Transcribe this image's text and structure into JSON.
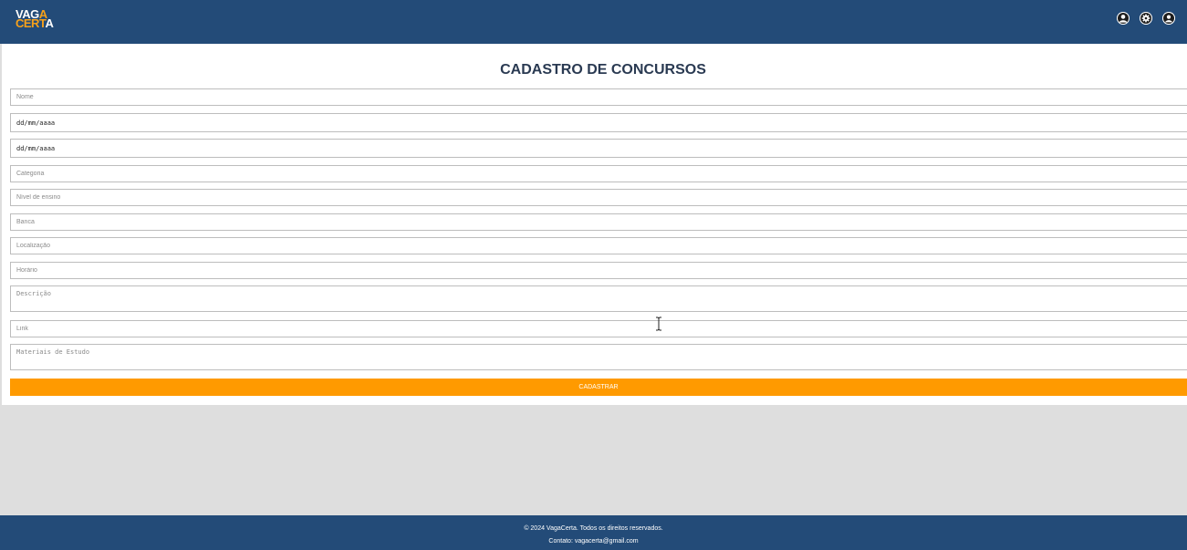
{
  "header": {
    "logo_line1_white": "VAG",
    "logo_line1_accent": "A",
    "logo_line2_accent": "CERT",
    "logo_line2_white": "A",
    "icons": [
      "user-circle-icon",
      "gear-icon",
      "account-icon"
    ]
  },
  "form": {
    "title": "CADASTRO DE CONCURSOS",
    "nome_placeholder": "Nome",
    "data_inicio_value": "dd/mm/aaaa",
    "data_fim_value": "dd/mm/aaaa",
    "categoria_placeholder": "Categoria",
    "nivel_placeholder": "Nível de ensino",
    "banca_placeholder": "Banca",
    "localizacao_placeholder": "Localização",
    "horario_placeholder": "Horário",
    "descricao_placeholder": "Descrição",
    "link_placeholder": "Link",
    "materiais_placeholder": "Materiais de Estudo",
    "submit_label": "CADASTRAR"
  },
  "footer": {
    "copyright": "© 2024 VagaCerta. Todos os direitos reservados.",
    "contact": "Contato: vagacerta@gmail.com"
  },
  "colors": {
    "header_bg": "#234b78",
    "accent": "#ff9a00",
    "page_bg": "#dedede"
  }
}
